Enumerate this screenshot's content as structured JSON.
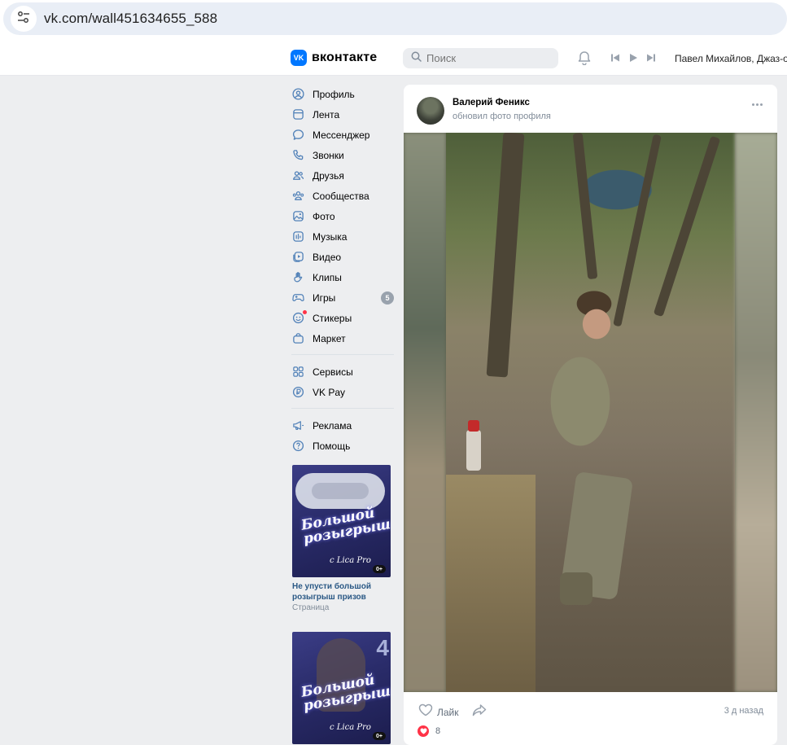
{
  "browser": {
    "url": "vk.com/wall451634655_588",
    "site_info_icon": "tune-icon"
  },
  "header": {
    "logo_text": "вконтакте",
    "logo_mark": "VK",
    "search_placeholder": "Поиск",
    "player_track": "Павел Михайлов, Джаз-оркестр",
    "icons": [
      "bell-icon",
      "prev-track-icon",
      "play-icon",
      "next-track-icon"
    ]
  },
  "sidebar": {
    "items": [
      {
        "label": "Профиль",
        "icon": "user-circle-icon"
      },
      {
        "label": "Лента",
        "icon": "newsfeed-icon"
      },
      {
        "label": "Мессенджер",
        "icon": "message-icon"
      },
      {
        "label": "Звонки",
        "icon": "phone-icon"
      },
      {
        "label": "Друзья",
        "icon": "users-icon"
      },
      {
        "label": "Сообщества",
        "icon": "communities-icon"
      },
      {
        "label": "Фото",
        "icon": "photo-icon"
      },
      {
        "label": "Музыка",
        "icon": "music-icon"
      },
      {
        "label": "Видео",
        "icon": "video-icon"
      },
      {
        "label": "Клипы",
        "icon": "clips-icon"
      },
      {
        "label": "Игры",
        "icon": "gamepad-icon",
        "badge": "5"
      },
      {
        "label": "Стикеры",
        "icon": "smile-icon"
      },
      {
        "label": "Маркет",
        "icon": "bag-icon"
      }
    ],
    "items2": [
      {
        "label": "Сервисы",
        "icon": "services-icon"
      },
      {
        "label": "VK Pay",
        "icon": "vkpay-icon"
      }
    ],
    "items3": [
      {
        "label": "Реклама",
        "icon": "megaphone-icon"
      },
      {
        "label": "Помощь",
        "icon": "help-icon"
      }
    ]
  },
  "ads": [
    {
      "title": "Не упусти большой розыгрыш призов",
      "subtitle": "Страница",
      "image_text": "Большой розыгрыш",
      "image_brand": "с Lica Pro",
      "age_label": "0+"
    },
    {
      "image_text": "Большой розыгрыш",
      "image_brand": "с Lica Pro",
      "age_label": "0+"
    }
  ],
  "post": {
    "author": "Валерий Феникс",
    "action": "обновил фото профиля",
    "like_label": "Лайк",
    "time": "3 д назад",
    "likes_count": "8",
    "colors": {
      "accent": "#0077ff",
      "heart": "#ff3347",
      "link": "#2a5885"
    }
  }
}
